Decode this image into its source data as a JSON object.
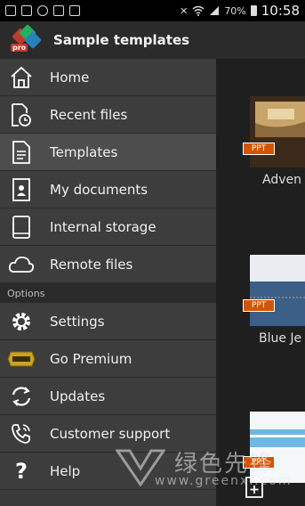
{
  "status_bar": {
    "battery": "70%",
    "time": "10:58"
  },
  "app_bar": {
    "title": "Sample templates",
    "logo_text": "pro"
  },
  "drawer": {
    "items": [
      {
        "label": "Home",
        "icon": "home-icon",
        "active": false
      },
      {
        "label": "Recent files",
        "icon": "recent-files-icon",
        "active": false
      },
      {
        "label": "Templates",
        "icon": "templates-icon",
        "active": true
      },
      {
        "label": "My documents",
        "icon": "my-documents-icon",
        "active": false
      },
      {
        "label": "Internal storage",
        "icon": "internal-storage-icon",
        "active": false
      },
      {
        "label": "Remote files",
        "icon": "cloud-icon",
        "active": false
      }
    ],
    "section_label": "Options",
    "options": [
      {
        "label": "Settings",
        "icon": "gear-icon"
      },
      {
        "label": "Go Premium",
        "icon": "premium-badge-icon"
      },
      {
        "label": "Updates",
        "icon": "updates-icon"
      },
      {
        "label": "Customer support",
        "icon": "customer-support-icon"
      },
      {
        "label": "Help",
        "icon": "help-icon"
      }
    ]
  },
  "templates": [
    {
      "name": "Adven",
      "badge": "PPT"
    },
    {
      "name": "Blue Je",
      "badge": "PPT"
    },
    {
      "name": "",
      "badge": "PPT"
    }
  ],
  "watermark": {
    "text": "绿色先锋",
    "url": "www.greenxf.com"
  },
  "colors": {
    "badge": "#d35400",
    "drawer_bg": "#3d3d3d",
    "active_bg": "#4d4d4d"
  }
}
